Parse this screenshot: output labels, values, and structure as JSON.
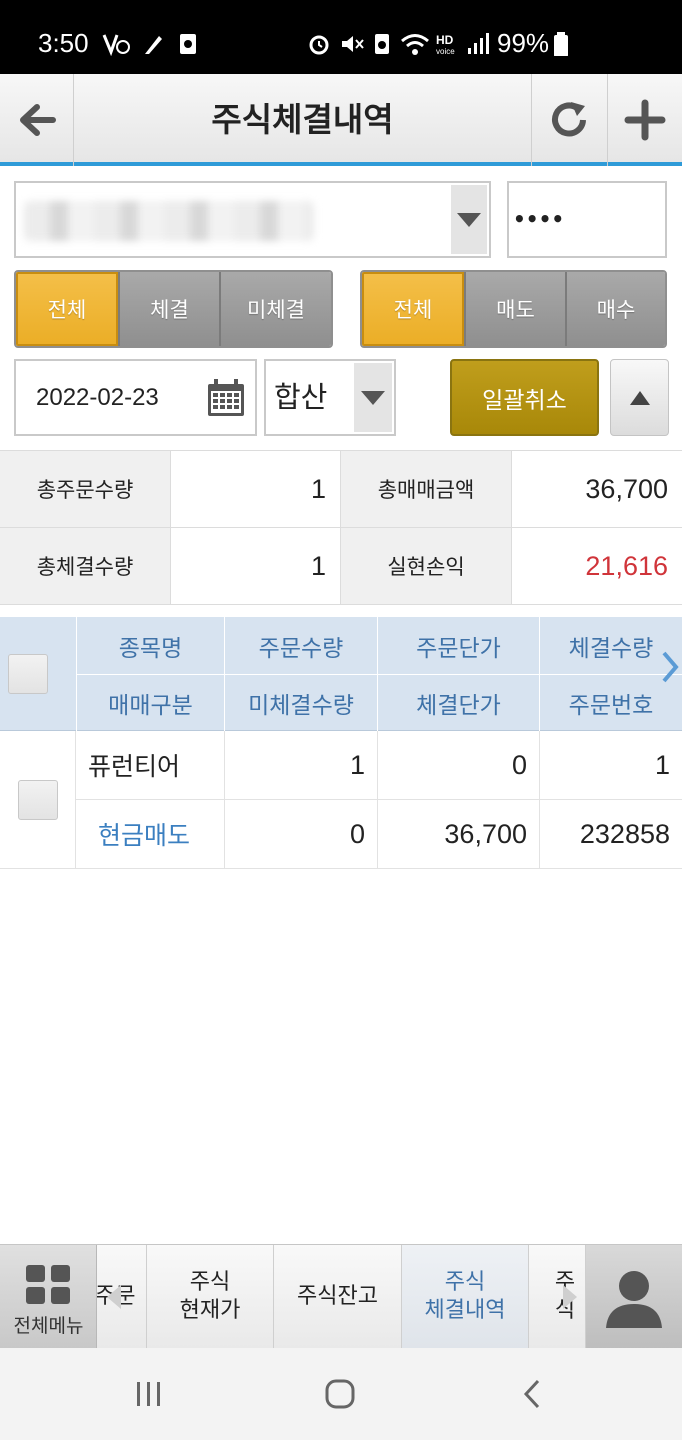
{
  "status_bar": {
    "time": "3:50",
    "battery": "99%"
  },
  "header": {
    "title": "주식체결내역"
  },
  "account": {
    "password_mask": "••••"
  },
  "filter_status": {
    "options": [
      "전체",
      "체결",
      "미체결"
    ],
    "selected": "전체"
  },
  "filter_side": {
    "options": [
      "전체",
      "매도",
      "매수"
    ],
    "selected": "전체"
  },
  "date": {
    "value": "2022-02-23"
  },
  "sum_mode": {
    "value": "합산"
  },
  "buttons": {
    "cancel_all": "일괄취소"
  },
  "summary": {
    "total_order_qty_label": "총주문수량",
    "total_order_qty": "1",
    "total_trade_amount_label": "총매매금액",
    "total_trade_amount": "36,700",
    "total_filled_qty_label": "총체결수량",
    "total_filled_qty": "1",
    "realized_pnl_label": "실현손익",
    "realized_pnl": "21,616",
    "pnl_color": "#d0343a"
  },
  "table": {
    "headers_row1": [
      "종목명",
      "주문수량",
      "주문단가",
      "체결수량"
    ],
    "headers_row2": [
      "매매구분",
      "미체결수량",
      "체결단가",
      "주문번호"
    ],
    "rows": [
      {
        "name": "퓨런티어",
        "order_qty": "1",
        "order_price": "0",
        "filled_qty": "1",
        "trade_type": "현금매도",
        "unfilled_qty": "0",
        "filled_price": "36,700",
        "order_no": "232858"
      }
    ]
  },
  "tabbar": {
    "menu_all": "전체메뉴",
    "tabs": [
      {
        "label": "주문",
        "partial": true
      },
      {
        "label": "주식\n현재가"
      },
      {
        "label": "주식잔고"
      },
      {
        "label": "주식\n체결내역",
        "active": true
      },
      {
        "label": "주식",
        "partial": true
      }
    ]
  },
  "colors": {
    "accent": "#2f9bd8",
    "active_segment": "#ebae27",
    "header_text": "#3f72a8",
    "cancel_button": "#a88809"
  }
}
